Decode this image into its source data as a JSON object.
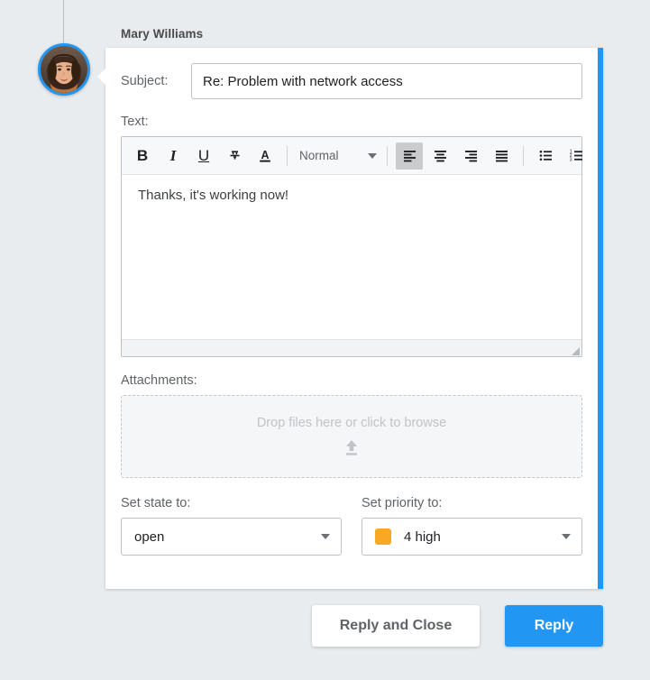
{
  "author": {
    "name": "Mary Williams",
    "avatar_icon": "user-photo-avatar",
    "avatar_ring_color": "#2196f3"
  },
  "card": {
    "accent_color": "#2196f3"
  },
  "subject": {
    "label": "Subject:",
    "value": "Re: Problem with network access",
    "placeholder": ""
  },
  "text": {
    "label": "Text:",
    "body": "Thanks, it's working now!",
    "toolbar": {
      "bold": {
        "icon": "bold-icon",
        "label": "B"
      },
      "italic": {
        "icon": "italic-icon",
        "label": "I"
      },
      "underline": {
        "icon": "underline-icon",
        "label": "U"
      },
      "strikethrough": {
        "icon": "strikethrough-icon",
        "label": "S"
      },
      "text_color": {
        "icon": "text-color-icon",
        "label": "A"
      },
      "format_select": {
        "icon": "chevron-down-icon",
        "value": "Normal"
      },
      "align_left": {
        "icon": "align-left-icon",
        "active": true
      },
      "align_center": {
        "icon": "align-center-icon",
        "active": false
      },
      "align_right": {
        "icon": "align-right-icon",
        "active": false
      },
      "align_justify": {
        "icon": "align-justify-icon",
        "active": false
      },
      "bullet_list": {
        "icon": "bullet-list-icon"
      },
      "numbered_list": {
        "icon": "numbered-list-icon"
      }
    },
    "resize_grip_icon": "resize-grip-icon"
  },
  "attachments": {
    "label": "Attachments:",
    "hint": "Drop files here or click to browse",
    "upload_icon": "upload-icon"
  },
  "state_select": {
    "label": "Set state to:",
    "value": "open",
    "caret_icon": "chevron-down-icon"
  },
  "priority_select": {
    "label": "Set priority to:",
    "value": "4 high",
    "swatch_color": "#f9a825",
    "caret_icon": "chevron-down-icon"
  },
  "actions": {
    "reply_and_close": "Reply and Close",
    "reply": "Reply",
    "reply_button_color": "#2196f3"
  }
}
